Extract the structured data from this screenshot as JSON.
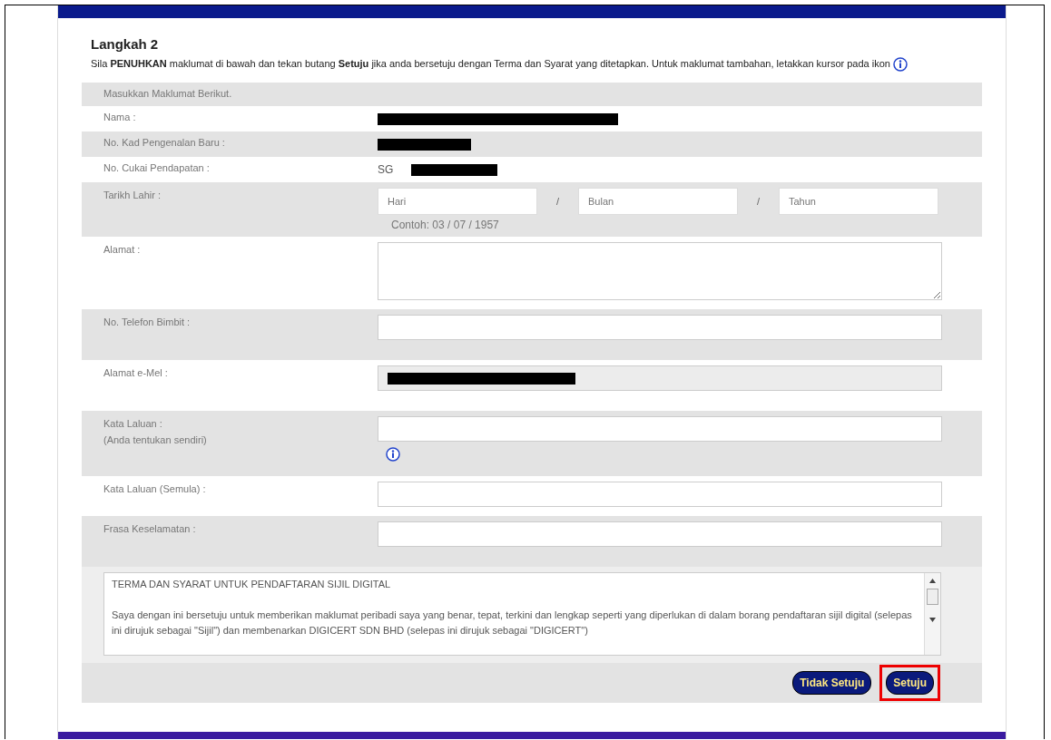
{
  "step": {
    "title": "Langkah 2",
    "instruction": "Sila **PENUHKAN** maklumat di bawah dan tekan butang **Setuju** jika anda bersetuju dengan Terma dan Syarat yang ditetapkan. Untuk maklumat tambahan, letakkan kursor pada ikon"
  },
  "form": {
    "heading": "Masukkan Maklumat Berikut.",
    "rows": [
      {
        "kind": "text",
        "label": "Nama :",
        "redacted": true
      },
      {
        "kind": "text",
        "label": "No. Kad Pengenalan Baru :",
        "redacted": true
      },
      {
        "kind": "text",
        "label": "No. Cukai Pendapatan :",
        "prefix": "SG",
        "redacted": true
      },
      {
        "kind": "date",
        "label": "Tarikh Lahir :",
        "placeholders": [
          "Hari",
          "Bulan",
          "Tahun"
        ],
        "separators": [
          "/",
          "/"
        ],
        "hint": "Contoh: 03 / 07 / 1957"
      },
      {
        "kind": "textarea",
        "label": "Alamat :"
      },
      {
        "kind": "input",
        "label": "No. Telefon Bimbit :"
      },
      {
        "kind": "input",
        "label": "Alamat e-Mel :",
        "readonly": true,
        "redacted": true
      },
      {
        "kind": "input",
        "label": "Kata Laluan :",
        "sublabel": "(Anda tentukan sendiri)",
        "info": true
      },
      {
        "kind": "input",
        "label": "Kata Laluan (Semula) :"
      },
      {
        "kind": "input",
        "label": "Frasa Keselamatan :"
      }
    ]
  },
  "terms": {
    "title": "TERMA DAN SYARAT UNTUK PENDAFTARAN SIJIL DIGITAL",
    "body": "Saya dengan ini bersetuju untuk memberikan maklumat peribadi saya yang benar, tepat, terkini dan lengkap seperti yang diperlukan di dalam borang pendaftaran sijil digital (selepas ini dirujuk sebagai \"Sijil\") dan membenarkan DIGICERT SDN BHD (selepas ini dirujuk sebagai \"DIGICERT\")"
  },
  "buttons": [
    {
      "label": "Tidak Setuju",
      "highlighted": false
    },
    {
      "label": "Setuju",
      "highlighted": true
    }
  ]
}
